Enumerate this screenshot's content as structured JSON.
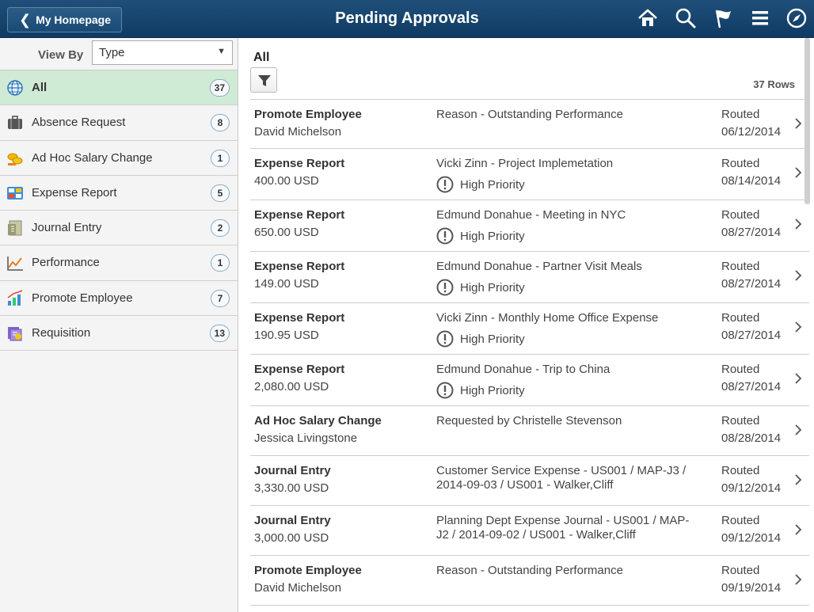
{
  "header": {
    "back_label": "My Homepage",
    "title": "Pending Approvals",
    "icons": [
      "home-icon",
      "search-icon",
      "flag-icon",
      "menu-icon",
      "compass-icon"
    ]
  },
  "sidebar": {
    "view_by_label": "View By",
    "view_by_value": "Type",
    "items": [
      {
        "label": "All",
        "count": "37",
        "icon": "globe-icon",
        "active": true
      },
      {
        "label": "Absence Request",
        "count": "8",
        "icon": "briefcase-icon"
      },
      {
        "label": "Ad Hoc Salary Change",
        "count": "1",
        "icon": "coins-icon"
      },
      {
        "label": "Expense Report",
        "count": "5",
        "icon": "expense-icon"
      },
      {
        "label": "Journal Entry",
        "count": "2",
        "icon": "journal-icon"
      },
      {
        "label": "Performance",
        "count": "1",
        "icon": "line-chart-icon"
      },
      {
        "label": "Promote Employee",
        "count": "7",
        "icon": "bar-chart-icon"
      },
      {
        "label": "Requisition",
        "count": "13",
        "icon": "requisition-icon"
      }
    ]
  },
  "main": {
    "title": "All",
    "rows_count": "37 Rows",
    "rows": [
      {
        "type": "Promote Employee",
        "sub": "David Michelson",
        "desc": "Reason - Outstanding Performance",
        "priority": "",
        "status": "Routed",
        "date": "06/12/2014"
      },
      {
        "type": "Expense Report",
        "sub": "400.00 USD",
        "desc": "Vicki Zinn - Project Implemetation",
        "priority": "High Priority",
        "status": "Routed",
        "date": "08/14/2014"
      },
      {
        "type": "Expense Report",
        "sub": "650.00 USD",
        "desc": "Edmund Donahue - Meeting in NYC",
        "priority": "High Priority",
        "status": "Routed",
        "date": "08/27/2014"
      },
      {
        "type": "Expense Report",
        "sub": "149.00 USD",
        "desc": "Edmund Donahue - Partner Visit Meals",
        "priority": "High Priority",
        "status": "Routed",
        "date": "08/27/2014"
      },
      {
        "type": "Expense Report",
        "sub": "190.95 USD",
        "desc": "Vicki Zinn - Monthly Home Office Expense",
        "priority": "High Priority",
        "status": "Routed",
        "date": "08/27/2014"
      },
      {
        "type": "Expense Report",
        "sub": "2,080.00 USD",
        "desc": "Edmund Donahue - Trip to China",
        "priority": "High Priority",
        "status": "Routed",
        "date": "08/27/2014"
      },
      {
        "type": "Ad Hoc Salary Change",
        "sub": "Jessica Livingstone",
        "desc": "Requested by Christelle Stevenson",
        "priority": "",
        "status": "Routed",
        "date": "08/28/2014"
      },
      {
        "type": "Journal Entry",
        "sub": "3,330.00 USD",
        "desc": "Customer Service Expense - US001 / MAP-J3 / 2014-09-03 / US001 - Walker,Cliff",
        "priority": "",
        "status": "Routed",
        "date": "09/12/2014"
      },
      {
        "type": "Journal Entry",
        "sub": "3,000.00 USD",
        "desc": "Planning Dept Expense Journal - US001 / MAP-J2 / 2014-09-02 / US001 - Walker,Cliff",
        "priority": "",
        "status": "Routed",
        "date": "09/12/2014"
      },
      {
        "type": "Promote Employee",
        "sub": "David Michelson",
        "desc": "Reason - Outstanding Performance",
        "priority": "",
        "status": "Routed",
        "date": "09/19/2014"
      }
    ]
  }
}
